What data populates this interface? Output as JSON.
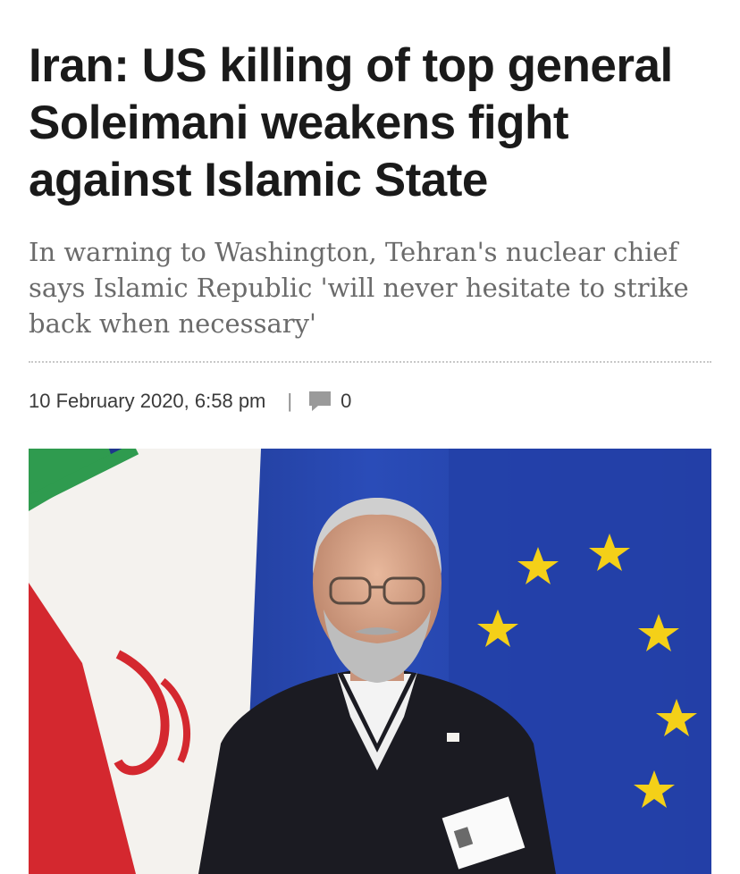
{
  "article": {
    "headline": "Iran: US killing of top general Soleimani weakens fight against Islamic State",
    "subheadline": "In warning to Washington, Tehran's nuclear chief says Islamic Republic 'will never hesitate to strike back when necessary'",
    "meta": {
      "date": "10 February 2020, 6:58 pm",
      "separator": "|",
      "comment_icon": "comment-icon",
      "comment_count": "0"
    },
    "photo": {
      "icon": "photo"
    }
  },
  "colors": {
    "headline": "#1a1a1a",
    "subheadline": "#6b6b6b",
    "meta": "#3a3a3a",
    "comment_icon": "#9a9a9a",
    "eu_blue": "#2340a8",
    "eu_star": "#f4d018",
    "iran_green": "#2f9b4f",
    "iran_red": "#d4282f"
  }
}
